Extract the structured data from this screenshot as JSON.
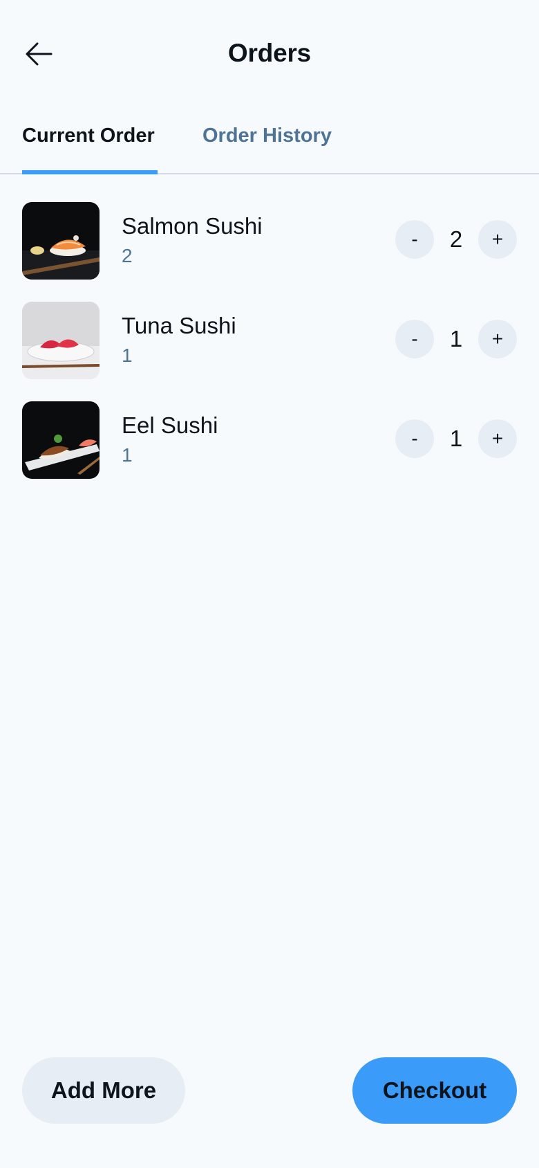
{
  "header": {
    "title": "Orders",
    "back_icon": "arrow-left-icon"
  },
  "tabs": [
    {
      "label": "Current Order",
      "active": true
    },
    {
      "label": "Order History",
      "active": false
    }
  ],
  "items": [
    {
      "name": "Salmon Sushi",
      "subtitle": "2",
      "quantity": "2",
      "minus": "-",
      "plus": "+",
      "image": "salmon-sushi-photo"
    },
    {
      "name": "Tuna Sushi",
      "subtitle": "1",
      "quantity": "1",
      "minus": "-",
      "plus": "+",
      "image": "tuna-sushi-photo"
    },
    {
      "name": "Eel Sushi",
      "subtitle": "1",
      "quantity": "1",
      "minus": "-",
      "plus": "+",
      "image": "eel-sushi-photo"
    }
  ],
  "footer": {
    "add_more_label": "Add More",
    "checkout_label": "Checkout"
  },
  "colors": {
    "accent": "#3a9cf8",
    "secondary_text": "#4e7397",
    "button_bg": "#e7edf4",
    "background": "#f7fafc"
  }
}
